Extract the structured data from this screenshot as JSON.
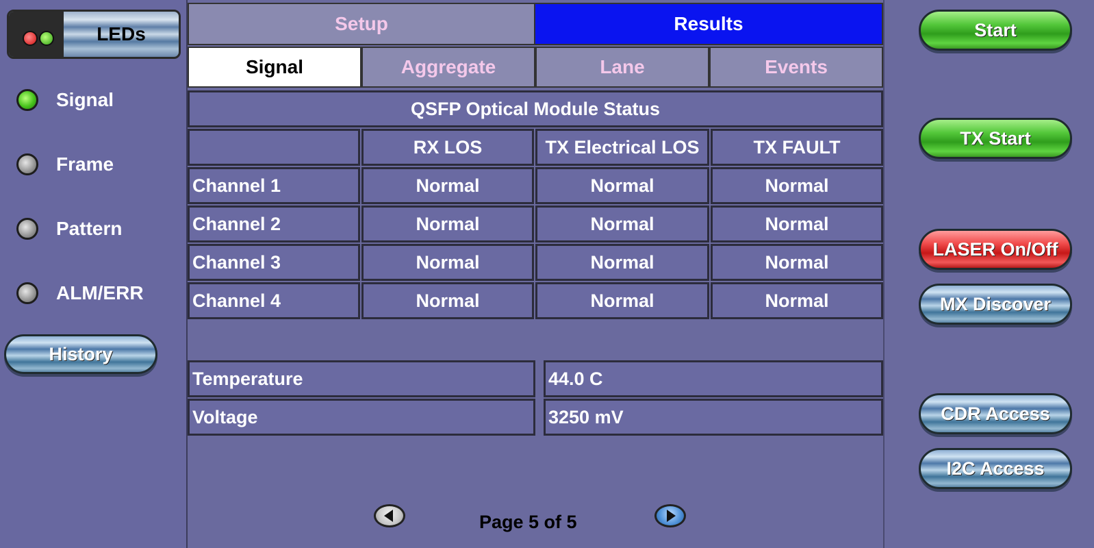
{
  "leds_panel": {
    "title": "LEDs",
    "indicators": [
      {
        "label": "Signal",
        "state": "green"
      },
      {
        "label": "Frame",
        "state": "gray"
      },
      {
        "label": "Pattern",
        "state": "gray"
      },
      {
        "label": "ALM/ERR",
        "state": "gray"
      }
    ],
    "history_label": "History"
  },
  "tabs": {
    "main": [
      {
        "label": "Setup",
        "active": false
      },
      {
        "label": "Results",
        "active": true
      }
    ],
    "sub": [
      {
        "label": "Signal",
        "active": true
      },
      {
        "label": "Aggregate",
        "active": false
      },
      {
        "label": "Lane",
        "active": false
      },
      {
        "label": "Events",
        "active": false
      }
    ]
  },
  "module_table": {
    "title": "QSFP Optical Module Status",
    "columns": [
      "",
      "RX LOS",
      "TX Electrical LOS",
      "TX FAULT"
    ],
    "rows": [
      {
        "channel": "Channel 1",
        "rx_los": "Normal",
        "tx_electrical_los": "Normal",
        "tx_fault": "Normal"
      },
      {
        "channel": "Channel 2",
        "rx_los": "Normal",
        "tx_electrical_los": "Normal",
        "tx_fault": "Normal"
      },
      {
        "channel": "Channel 3",
        "rx_los": "Normal",
        "tx_electrical_los": "Normal",
        "tx_fault": "Normal"
      },
      {
        "channel": "Channel 4",
        "rx_los": "Normal",
        "tx_electrical_los": "Normal",
        "tx_fault": "Normal"
      }
    ]
  },
  "metrics": [
    {
      "label": "Temperature",
      "value": "44.0 C"
    },
    {
      "label": "Voltage",
      "value": "3250 mV"
    }
  ],
  "pagination": {
    "text": "Page 5 of 5"
  },
  "actions": {
    "start": "Start",
    "tx_start": "TX Start",
    "laser": "LASER On/Off",
    "mx_discover": "MX Discover",
    "cdr_access": "CDR Access",
    "i2c_access": "I2C Access"
  },
  "colors": {
    "background": "#6a6a9e",
    "active_tab": "#0a14f0",
    "inactive_tab_text": "#f4c8ea",
    "led_green": "#47c21c",
    "laser_button": "#e23a3a",
    "start_button": "#3fb02a"
  }
}
